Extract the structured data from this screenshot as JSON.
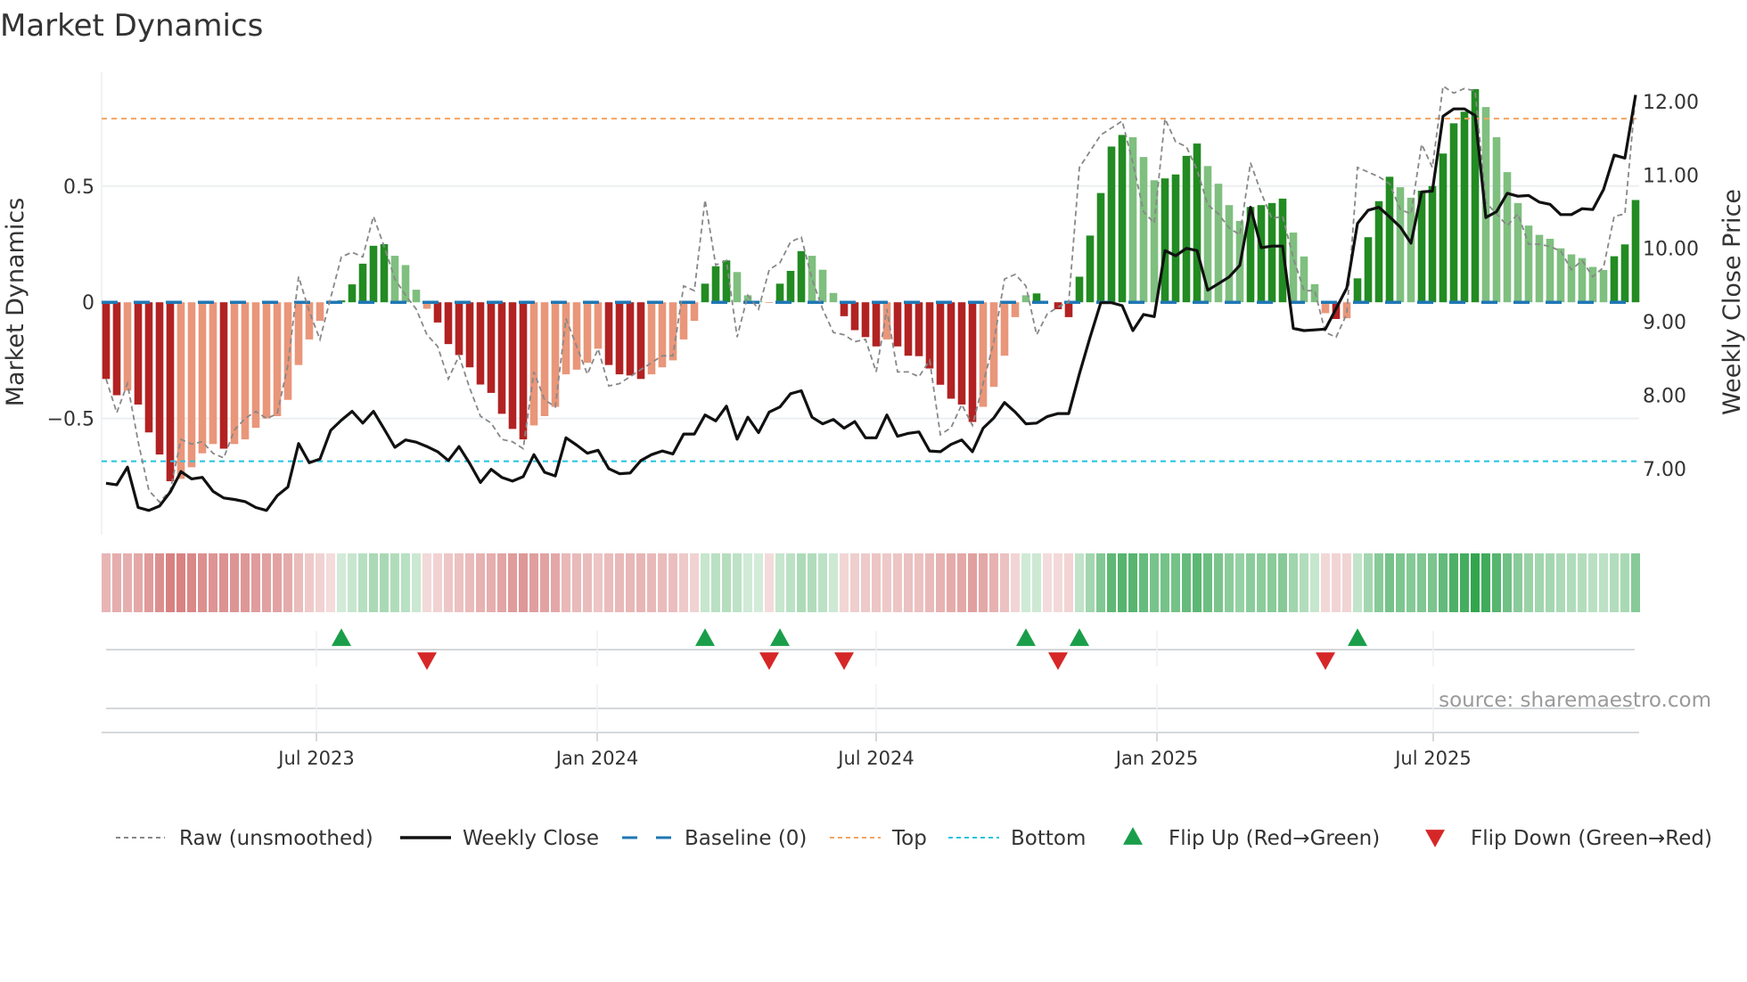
{
  "title": "Market Dynamics",
  "source": "source: sharemaestro.com",
  "chart_data": {
    "type": "bar",
    "title": "Market Dynamics",
    "ylabel": "Market Dynamics",
    "y2label": "Weekly Close Price",
    "ylim": [
      -1.0,
      0.99
    ],
    "y2lim": [
      6.1,
      12.4
    ],
    "y_ticks": [
      {
        "value": 0.5,
        "label": "0.5"
      },
      {
        "value": 0,
        "label": "0"
      },
      {
        "value": -0.5,
        "label": "−0.5"
      }
    ],
    "y2_ticks": [
      {
        "value": 12,
        "label": "12.00"
      },
      {
        "value": 11,
        "label": "11.00"
      },
      {
        "value": 10,
        "label": "10.00"
      },
      {
        "value": 9,
        "label": "9.00"
      },
      {
        "value": 8,
        "label": "8.00"
      },
      {
        "value": 7,
        "label": "7.00"
      }
    ],
    "x_unit": "week index",
    "x_ticks": [
      {
        "label": "Jul 2023",
        "week_index": 19.67
      },
      {
        "label": "Jan 2024",
        "week_index": 45.92
      },
      {
        "label": "Jul 2024",
        "week_index": 72.0
      },
      {
        "label": "Jan 2025",
        "week_index": 98.25
      },
      {
        "label": "Jul 2025",
        "week_index": 124.08
      }
    ],
    "grid": true,
    "legend_position": "bottom",
    "thresholds": {
      "baseline": 0,
      "top": 0.79,
      "bottom": -0.684
    },
    "colors": {
      "bar_neg_strong": "#b22222",
      "bar_neg_weak": "#e9967a",
      "bar_pos_strong": "#228b22",
      "bar_pos_weak": "#7fbf7f",
      "baseline": "#1f77b4",
      "top": "#f4a460",
      "bottom": "#22c3e0",
      "raw": "#888888",
      "close": "#111111",
      "flip_up": "#1a9e4a",
      "flip_down": "#d62728",
      "heat_neg": "#c85050",
      "heat_pos": "#28a046"
    },
    "series": [
      {
        "name": "Market Dynamics (smoothed)",
        "type": "bar",
        "values": [
          -0.33,
          -0.4,
          -0.38,
          -0.44,
          -0.56,
          -0.655,
          -0.77,
          -0.76,
          -0.71,
          -0.65,
          -0.61,
          -0.63,
          -0.61,
          -0.59,
          -0.54,
          -0.5,
          -0.49,
          -0.42,
          -0.27,
          -0.16,
          -0.08,
          0,
          0.008,
          0.077,
          0.166,
          0.243,
          0.25,
          0.2,
          0.16,
          0.054,
          -0.028,
          -0.087,
          -0.18,
          -0.227,
          -0.28,
          -0.354,
          -0.39,
          -0.48,
          -0.545,
          -0.59,
          -0.53,
          -0.49,
          -0.45,
          -0.31,
          -0.29,
          -0.26,
          -0.2,
          -0.27,
          -0.31,
          -0.315,
          -0.33,
          -0.31,
          -0.28,
          -0.25,
          -0.16,
          -0.08,
          0.08,
          0.155,
          0.18,
          0.13,
          0.03,
          0.005,
          -0.003,
          0.08,
          0.135,
          0.22,
          0.2,
          0.14,
          0.04,
          -0.06,
          -0.12,
          -0.15,
          -0.19,
          -0.16,
          -0.19,
          -0.23,
          -0.232,
          -0.285,
          -0.355,
          -0.415,
          -0.44,
          -0.515,
          -0.45,
          -0.364,
          -0.23,
          -0.064,
          0.03,
          0.038,
          0,
          -0.03,
          -0.064,
          0.11,
          0.287,
          0.47,
          0.67,
          0.72,
          0.71,
          0.625,
          0.525,
          0.533,
          0.55,
          0.63,
          0.683,
          0.586,
          0.51,
          0.418,
          0.35,
          0.41,
          0.418,
          0.427,
          0.446,
          0.3,
          0.197,
          0.078,
          -0.047,
          -0.072,
          -0.069,
          0.103,
          0.28,
          0.435,
          0.54,
          0.495,
          0.45,
          0.48,
          0.5,
          0.64,
          0.77,
          0.82,
          0.917,
          0.84,
          0.71,
          0.56,
          0.427,
          0.33,
          0.29,
          0.273,
          0.232,
          0.206,
          0.19,
          0.152,
          0.139,
          0.198,
          0.249,
          0.44
        ]
      },
      {
        "name": "Raw (unsmoothed)",
        "type": "line",
        "values": [
          -0.33,
          -0.475,
          -0.35,
          -0.6,
          -0.81,
          -0.86,
          -0.81,
          -0.59,
          -0.61,
          -0.6,
          -0.65,
          -0.67,
          -0.55,
          -0.5,
          -0.47,
          -0.5,
          -0.48,
          -0.27,
          0.11,
          -0.04,
          -0.16,
          0.02,
          0.195,
          0.215,
          0.195,
          0.37,
          0.24,
          0.1,
          0.03,
          -0.03,
          -0.14,
          -0.19,
          -0.33,
          -0.23,
          -0.37,
          -0.49,
          -0.52,
          -0.59,
          -0.6,
          -0.63,
          -0.3,
          -0.42,
          -0.45,
          -0.07,
          -0.19,
          -0.31,
          -0.2,
          -0.36,
          -0.35,
          -0.32,
          -0.29,
          -0.26,
          -0.23,
          -0.23,
          0.07,
          0.05,
          0.44,
          0.16,
          0.18,
          -0.15,
          0.03,
          -0.03,
          0.14,
          0.17,
          0.26,
          0.28,
          0.1,
          -0.03,
          -0.13,
          -0.14,
          -0.17,
          -0.16,
          -0.3,
          -0.03,
          -0.3,
          -0.3,
          -0.32,
          -0.25,
          -0.57,
          -0.54,
          -0.44,
          -0.53,
          -0.35,
          -0.17,
          0.1,
          0.12,
          0.07,
          -0.14,
          -0.05,
          -0.02,
          0.0,
          0.58,
          0.65,
          0.72,
          0.75,
          0.78,
          0.6,
          0.39,
          0.34,
          0.79,
          0.69,
          0.67,
          0.57,
          0.42,
          0.38,
          0.32,
          0.29,
          0.6,
          0.47,
          0.36,
          0.37,
          0.19,
          0.05,
          0.05,
          -0.13,
          -0.15,
          -0.05,
          0.58,
          0.56,
          0.54,
          0.51,
          0.4,
          0.38,
          0.68,
          0.58,
          0.93,
          0.9,
          0.92,
          0.91,
          0.43,
          0.38,
          0.33,
          0.38,
          0.25,
          0.25,
          0.24,
          0.22,
          0.14,
          0.18,
          0.11,
          0.15,
          0.37,
          0.38,
          0.89
        ]
      },
      {
        "name": "Weekly Close",
        "type": "line",
        "axis": "right",
        "values": [
          6.8,
          6.78,
          7.02,
          6.47,
          6.43,
          6.49,
          6.68,
          6.96,
          6.86,
          6.88,
          6.69,
          6.6,
          6.58,
          6.55,
          6.47,
          6.43,
          6.63,
          6.75,
          7.34,
          7.08,
          7.13,
          7.52,
          7.66,
          7.78,
          7.62,
          7.78,
          7.54,
          7.29,
          7.39,
          7.36,
          7.3,
          7.23,
          7.11,
          7.3,
          7.07,
          6.81,
          6.99,
          6.88,
          6.83,
          6.89,
          7.19,
          6.95,
          6.9,
          7.42,
          7.32,
          7.21,
          7.25,
          7.0,
          6.93,
          6.94,
          7.11,
          7.19,
          7.24,
          7.2,
          7.47,
          7.47,
          7.73,
          7.65,
          7.85,
          7.4,
          7.7,
          7.49,
          7.77,
          7.84,
          8.02,
          8.06,
          7.7,
          7.61,
          7.67,
          7.55,
          7.64,
          7.42,
          7.42,
          7.73,
          7.44,
          7.48,
          7.5,
          7.24,
          7.23,
          7.33,
          7.39,
          7.23,
          7.55,
          7.69,
          7.9,
          7.77,
          7.61,
          7.62,
          7.71,
          7.75,
          7.75,
          8.29,
          8.79,
          9.26,
          9.26,
          9.22,
          8.88,
          9.1,
          9.07,
          9.97,
          9.9,
          10.0,
          9.97,
          9.43,
          9.52,
          9.61,
          9.77,
          10.56,
          10.01,
          10.03,
          10.03,
          8.91,
          8.88,
          8.89,
          8.9,
          9.18,
          9.46,
          10.34,
          10.52,
          10.56,
          10.43,
          10.29,
          10.07,
          10.77,
          10.78,
          11.8,
          11.9,
          11.9,
          11.81,
          10.42,
          10.5,
          10.75,
          10.71,
          10.72,
          10.63,
          10.6,
          10.46,
          10.46,
          10.54,
          10.53,
          10.8,
          11.27,
          11.23,
          12.09
        ]
      }
    ],
    "flips_up": [
      22,
      56,
      63,
      86,
      91,
      117
    ],
    "flips_down": [
      30,
      62,
      69,
      89,
      114
    ],
    "legend": [
      {
        "key": "raw",
        "label": "Raw (unsmoothed)"
      },
      {
        "key": "close",
        "label": "Weekly Close"
      },
      {
        "key": "baseline",
        "label": "Baseline (0)"
      },
      {
        "key": "top",
        "label": "Top"
      },
      {
        "key": "bottom",
        "label": "Bottom"
      },
      {
        "key": "flip_up",
        "label": "Flip Up (Red→Green)"
      },
      {
        "key": "flip_down",
        "label": "Flip Down (Green→Red)"
      }
    ]
  }
}
